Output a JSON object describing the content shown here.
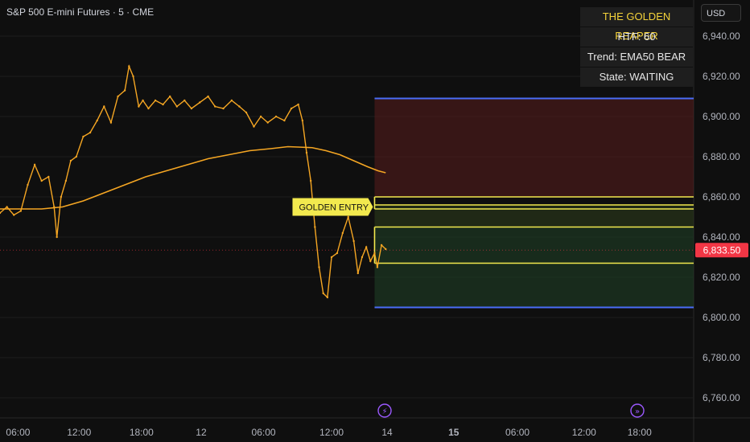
{
  "header": {
    "symbol": "S&P 500 E-mini Futures · 5 · CME",
    "currency": "USD"
  },
  "info_panel": {
    "title": "THE GOLDEN REAPER",
    "htf": "HTF: 60",
    "trend": "Trend: EMA50 BEAR",
    "state": "State: WAITING"
  },
  "colors": {
    "background": "#0f0f0f",
    "price": "#f5a623",
    "ema": "#f5a623",
    "blue_line": "#4a6cf7",
    "yellow_line": "#f2e94e",
    "red_zone": "#5a1d1d",
    "green_zone": "#1e3d24",
    "last_price_bg": "#f23645"
  },
  "chart_data": {
    "type": "line",
    "yticks": [
      6940,
      6920,
      6900,
      6880,
      6860,
      6840,
      6820,
      6800,
      6780,
      6760
    ],
    "ytick_labels": [
      "6,940.00",
      "6,920.00",
      "6,900.00",
      "6,880.00",
      "6,860.00",
      "6,840.00",
      "6,820.00",
      "6,800.00",
      "6,780.00",
      "6,760.00"
    ],
    "ylim": [
      6750,
      6958
    ],
    "xlim": [
      0,
      100
    ],
    "xticks": [
      {
        "x": 2.6,
        "label": "06:00",
        "bold": false
      },
      {
        "x": 11.4,
        "label": "12:00",
        "bold": false
      },
      {
        "x": 20.4,
        "label": "18:00",
        "bold": false
      },
      {
        "x": 29.0,
        "label": "12",
        "bold": false
      },
      {
        "x": 38.0,
        "label": "06:00",
        "bold": false
      },
      {
        "x": 47.8,
        "label": "12:00",
        "bold": false
      },
      {
        "x": 55.8,
        "label": "14",
        "bold": false
      },
      {
        "x": 65.4,
        "label": "15",
        "bold": true
      },
      {
        "x": 74.6,
        "label": "06:00",
        "bold": false
      },
      {
        "x": 84.2,
        "label": "12:00",
        "bold": false
      },
      {
        "x": 92.2,
        "label": "18:00",
        "bold": false
      }
    ],
    "price_series": [
      [
        0,
        6852
      ],
      [
        1,
        6855
      ],
      [
        2,
        6851
      ],
      [
        3,
        6853
      ],
      [
        4,
        6866
      ],
      [
        5,
        6876
      ],
      [
        6,
        6868
      ],
      [
        7,
        6870
      ],
      [
        7.8,
        6855
      ],
      [
        8.2,
        6840
      ],
      [
        8.8,
        6860
      ],
      [
        9.5,
        6868
      ],
      [
        10.2,
        6878
      ],
      [
        11,
        6880
      ],
      [
        12,
        6890
      ],
      [
        13,
        6892
      ],
      [
        14,
        6898
      ],
      [
        15,
        6905
      ],
      [
        16,
        6897
      ],
      [
        17,
        6910
      ],
      [
        18,
        6913
      ],
      [
        18.6,
        6925
      ],
      [
        19.2,
        6920
      ],
      [
        20,
        6905
      ],
      [
        20.6,
        6908
      ],
      [
        21.4,
        6904
      ],
      [
        22.4,
        6908
      ],
      [
        23.5,
        6906
      ],
      [
        24.5,
        6910
      ],
      [
        25.5,
        6905
      ],
      [
        26.6,
        6908
      ],
      [
        27.6,
        6904
      ],
      [
        28.8,
        6907
      ],
      [
        30,
        6910
      ],
      [
        31,
        6905
      ],
      [
        32.2,
        6904
      ],
      [
        33.4,
        6908
      ],
      [
        34.5,
        6905
      ],
      [
        35.5,
        6902
      ],
      [
        36.6,
        6895
      ],
      [
        37.6,
        6900
      ],
      [
        38.6,
        6897
      ],
      [
        39.8,
        6900
      ],
      [
        41,
        6898
      ],
      [
        42,
        6904
      ],
      [
        43,
        6906
      ],
      [
        43.6,
        6898
      ],
      [
        44.2,
        6882
      ],
      [
        44.8,
        6868
      ],
      [
        45.4,
        6845
      ],
      [
        46,
        6825
      ],
      [
        46.6,
        6812
      ],
      [
        47.2,
        6810
      ],
      [
        47.8,
        6830
      ],
      [
        48.6,
        6832
      ],
      [
        49.4,
        6842
      ],
      [
        50.2,
        6850
      ],
      [
        51,
        6838
      ],
      [
        51.6,
        6822
      ],
      [
        52.2,
        6830
      ],
      [
        52.8,
        6835
      ],
      [
        53.4,
        6828
      ],
      [
        54,
        6832
      ],
      [
        54.4,
        6825
      ],
      [
        55,
        6836
      ],
      [
        55.6,
        6834
      ]
    ],
    "ema_series": [
      [
        0,
        6854
      ],
      [
        6,
        6854
      ],
      [
        9,
        6855
      ],
      [
        12,
        6858
      ],
      [
        15,
        6862
      ],
      [
        18,
        6866
      ],
      [
        21,
        6870
      ],
      [
        24,
        6873
      ],
      [
        27,
        6876
      ],
      [
        30,
        6879
      ],
      [
        33,
        6881
      ],
      [
        36,
        6883
      ],
      [
        39,
        6884
      ],
      [
        41.5,
        6885
      ],
      [
        43,
        6884.8
      ],
      [
        45,
        6884.5
      ],
      [
        47,
        6883
      ],
      [
        49,
        6881
      ],
      [
        51,
        6878
      ],
      [
        53,
        6875
      ],
      [
        54.5,
        6873
      ],
      [
        55.6,
        6872
      ]
    ],
    "zones": {
      "start_x": 54.0,
      "stop_upper": 6909,
      "entry_upper": 6860,
      "entry_upper2": 6856,
      "entry_lower": 6854,
      "tp_upper": 6845,
      "tp_lower": 6827,
      "stop_lower": 6805
    },
    "last_price": 6833.5,
    "last_price_label": "6,833.50",
    "label_text": "GOLDEN ENTRY",
    "label_price": 6855
  }
}
